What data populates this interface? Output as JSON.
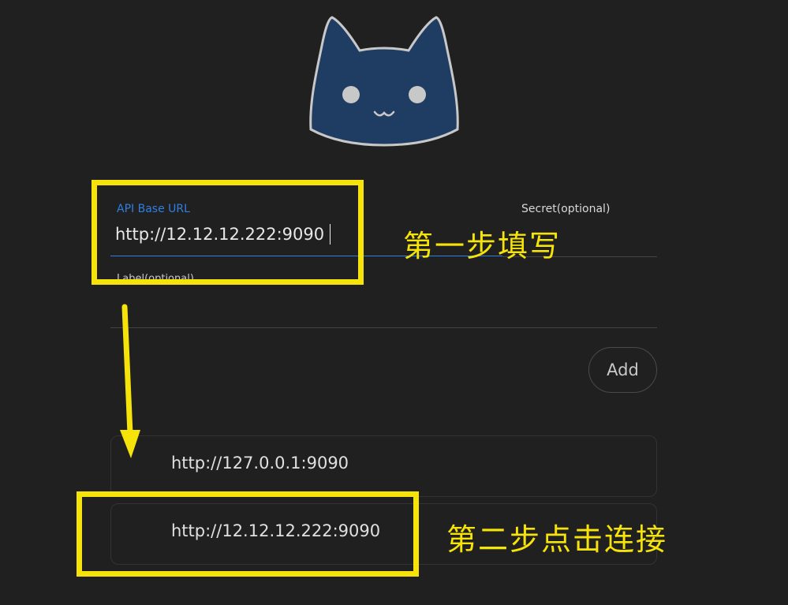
{
  "logo": {
    "icon": "cat-face-icon",
    "color": "#1f3d62"
  },
  "form": {
    "api_base_url": {
      "label": "API Base URL",
      "value": "http://12.12.12.222:9090"
    },
    "secret": {
      "label": "Secret(optional)",
      "value": ""
    },
    "label_field": {
      "label": "Label(optional)",
      "value": ""
    },
    "add_button": "Add"
  },
  "backends": [
    {
      "url": "http://127.0.0.1:9090"
    },
    {
      "url": "http://12.12.12.222:9090"
    }
  ],
  "annotations": {
    "step1": "第一步填写",
    "step2": "第二步点击连接",
    "color": "#f5e30a"
  },
  "colors": {
    "background": "#202020",
    "accent": "#2f7fe0"
  }
}
